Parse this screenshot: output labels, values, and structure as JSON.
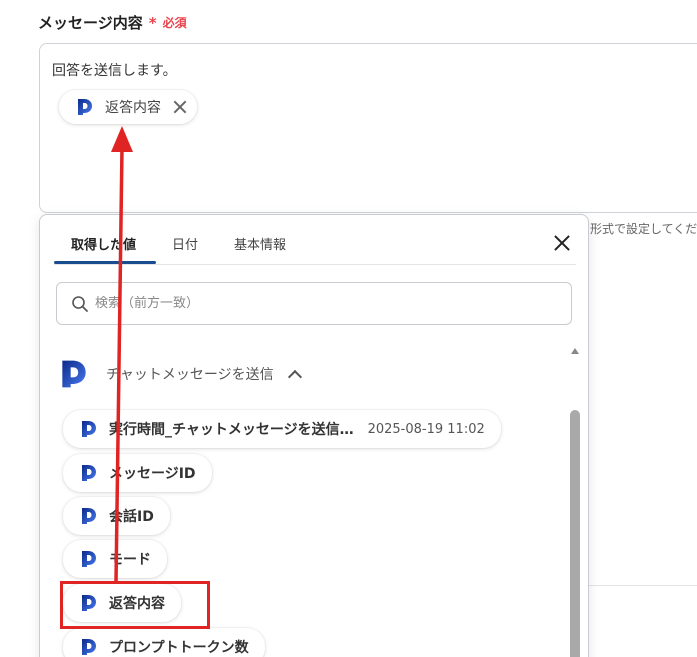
{
  "field": {
    "label": "メッセージ内容",
    "required_star": "*",
    "required_text": "必須"
  },
  "message": {
    "text": "回答を送信します。",
    "inserted_chip": "返答内容"
  },
  "hint_text": "形式で設定してくださ",
  "popup": {
    "tabs": [
      {
        "label": "取得した値",
        "active": true
      },
      {
        "label": "日付",
        "active": false
      },
      {
        "label": "基本情報",
        "active": false
      }
    ],
    "search_placeholder": "検索（前方一致）",
    "group_title": "チャットメッセージを送信",
    "items": [
      {
        "label": "実行時間_チャットメッセージを送信…",
        "value": "2025-08-19 11:02"
      },
      {
        "label": "メッセージID",
        "value": ""
      },
      {
        "label": "会話ID",
        "value": ""
      },
      {
        "label": "モード",
        "value": ""
      },
      {
        "label": "返答内容",
        "value": ""
      },
      {
        "label": "プロンプトトークン数",
        "value": ""
      }
    ]
  },
  "colors": {
    "required": "#e8454d",
    "tab_underline": "#1a4d8f",
    "annotation": "#e02424",
    "icon_dark": "#0b2a8a",
    "icon_light": "#4a7bf0"
  }
}
